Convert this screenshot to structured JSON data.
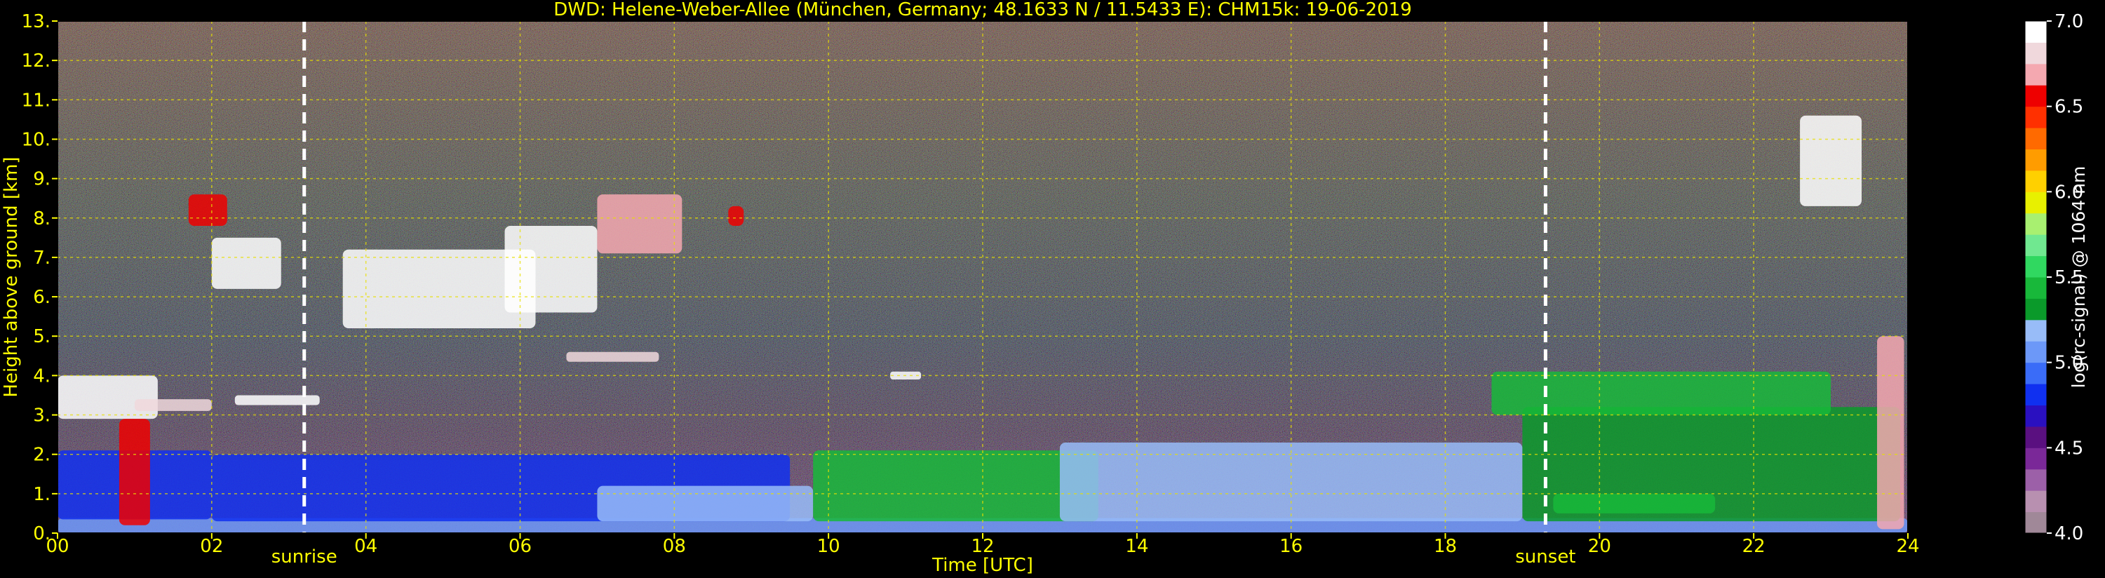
{
  "chart_data": {
    "type": "heatmap",
    "title": "DWD: Helene-Weber-Allee (München, Germany; 48.1633 N / 11.5433 E):    CHM15k: 19-06-2019",
    "xlabel": "Time [UTC]",
    "ylabel": "Height above ground [km]",
    "xlim": [
      0,
      24
    ],
    "ylim": [
      0,
      13
    ],
    "x_ticks": [
      0,
      2,
      4,
      6,
      8,
      10,
      12,
      14,
      16,
      18,
      20,
      22,
      24
    ],
    "x_tick_labels": [
      "00",
      "02",
      "04",
      "06",
      "08",
      "10",
      "12",
      "14",
      "16",
      "18",
      "20",
      "22",
      "24"
    ],
    "y_ticks": [
      0,
      1,
      2,
      3,
      4,
      5,
      6,
      7,
      8,
      9,
      10,
      11,
      12,
      13
    ],
    "y_tick_labels": [
      "0.",
      "1.",
      "2.",
      "3.",
      "4.",
      "5.",
      "6.",
      "7.",
      "8.",
      "9.",
      "10.",
      "11.",
      "12.",
      "13."
    ],
    "grid": true,
    "annotations": [
      {
        "label": "sunrise",
        "x": 3.2
      },
      {
        "label": "sunset",
        "x": 19.3
      }
    ],
    "colorbar": {
      "label": "log(rc-signal) @ 1064 nm",
      "range": [
        4.0,
        7.0
      ],
      "ticks": [
        4.0,
        4.5,
        5.0,
        5.5,
        6.0,
        6.5,
        7.0
      ],
      "tick_labels": [
        "4.0",
        "4.5",
        "5.0",
        "5.5",
        "6.0",
        "6.5",
        "7.0"
      ],
      "colors": [
        "#a08898",
        "#b890b0",
        "#9c60a8",
        "#7a2898",
        "#5a1080",
        "#2a10c0",
        "#1030f0",
        "#3a6cf8",
        "#6c98f8",
        "#98bcf8",
        "#0a9a2a",
        "#18b83a",
        "#30d860",
        "#70e890",
        "#a8f070",
        "#e8f000",
        "#ffd000",
        "#ff9c00",
        "#ff6a00",
        "#ff3000",
        "#ee0000",
        "#f4a8b0",
        "#f0d8dc",
        "#ffffff"
      ]
    },
    "features": [
      {
        "x0": 0.0,
        "x1": 24.0,
        "y0": 0.0,
        "y1": 0.38,
        "value": 5.05
      },
      {
        "x0": 0.0,
        "x1": 2.0,
        "y0": 0.35,
        "y1": 2.1,
        "value": 4.75
      },
      {
        "x0": 2.0,
        "x1": 9.5,
        "y0": 0.3,
        "y1": 2.0,
        "value": 4.8
      },
      {
        "x0": 7.0,
        "x1": 9.8,
        "y0": 0.3,
        "y1": 1.2,
        "value": 5.15
      },
      {
        "x0": 9.8,
        "x1": 13.5,
        "y0": 0.3,
        "y1": 2.1,
        "value": 5.4
      },
      {
        "x0": 13.0,
        "x1": 19.0,
        "y0": 0.3,
        "y1": 2.3,
        "value": 5.2
      },
      {
        "x0": 19.0,
        "x1": 23.9,
        "y0": 0.3,
        "y1": 3.2,
        "value": 5.25
      },
      {
        "x0": 19.4,
        "x1": 21.5,
        "y0": 0.5,
        "y1": 1.0,
        "value": 5.45
      },
      {
        "x0": 18.6,
        "x1": 23.0,
        "y0": 3.0,
        "y1": 4.1,
        "value": 5.4
      },
      {
        "x0": 0.0,
        "x1": 1.3,
        "y0": 2.9,
        "y1": 4.0,
        "value": 6.9
      },
      {
        "x0": 0.8,
        "x1": 1.2,
        "y0": 0.2,
        "y1": 2.9,
        "value": 6.5
      },
      {
        "x0": 1.0,
        "x1": 2.0,
        "y0": 3.1,
        "y1": 3.4,
        "value": 6.8
      },
      {
        "x0": 1.7,
        "x1": 2.2,
        "y0": 7.8,
        "y1": 8.6,
        "value": 6.6
      },
      {
        "x0": 2.0,
        "x1": 2.9,
        "y0": 6.2,
        "y1": 7.5,
        "value": 6.9
      },
      {
        "x0": 2.3,
        "x1": 3.4,
        "y0": 3.25,
        "y1": 3.5,
        "value": 6.9
      },
      {
        "x0": 3.7,
        "x1": 6.2,
        "y0": 5.2,
        "y1": 7.2,
        "value": 6.9
      },
      {
        "x0": 5.8,
        "x1": 7.0,
        "y0": 5.6,
        "y1": 7.8,
        "value": 6.9
      },
      {
        "x0": 7.0,
        "x1": 8.1,
        "y0": 7.1,
        "y1": 8.6,
        "value": 6.7
      },
      {
        "x0": 6.6,
        "x1": 7.8,
        "y0": 4.35,
        "y1": 4.6,
        "value": 6.8
      },
      {
        "x0": 10.8,
        "x1": 11.2,
        "y0": 3.9,
        "y1": 4.1,
        "value": 6.95
      },
      {
        "x0": 8.7,
        "x1": 8.9,
        "y0": 7.8,
        "y1": 8.3,
        "value": 6.6
      },
      {
        "x0": 22.6,
        "x1": 23.4,
        "y0": 8.3,
        "y1": 10.6,
        "value": 6.9
      },
      {
        "x0": 23.6,
        "x1": 23.95,
        "y0": 0.1,
        "y1": 5.0,
        "value": 6.7
      }
    ]
  }
}
